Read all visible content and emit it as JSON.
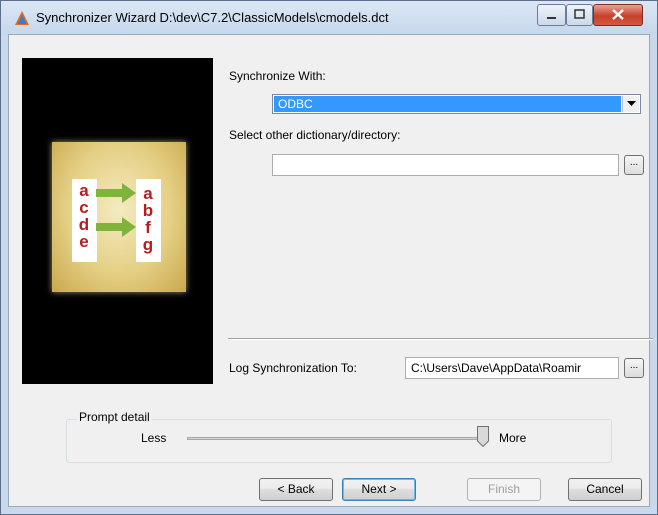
{
  "window": {
    "title": "Synchronizer Wizard D:\\dev\\C7.2\\ClassicModels\\cmodels.dct",
    "controls": {
      "minimize": "minimize",
      "maximize": "maximize",
      "close": "close"
    }
  },
  "banner": {
    "left_letters": [
      "a",
      "c",
      "d",
      "e"
    ],
    "right_letters": [
      "a",
      "b",
      "f",
      "g"
    ]
  },
  "sync": {
    "label": "Synchronize With:",
    "selected": "ODBC",
    "other_label": "Select other dictionary/directory:",
    "other_value": "",
    "browse_label": "..."
  },
  "log": {
    "label": "Log Synchronization To:",
    "value": "C:\\Users\\Dave\\AppData\\Roamir",
    "browse_label": "..."
  },
  "prompt": {
    "title": "Prompt detail",
    "less": "Less",
    "more": "More",
    "level": 1.0
  },
  "buttons": {
    "back": "< Back",
    "next": "Next >",
    "finish": "Finish",
    "cancel": "Cancel"
  },
  "colors": {
    "accent": "#3399ff",
    "arrow": "#7fb33b"
  }
}
